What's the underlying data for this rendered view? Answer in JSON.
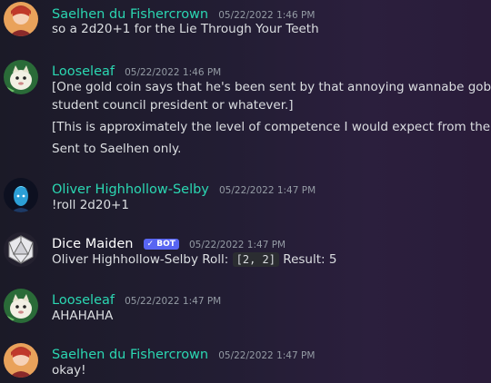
{
  "messages": [
    {
      "author": "Saelhen du Fishercrown",
      "timestamp": "05/22/2022 1:46 PM",
      "name_color": "#2bd7b2",
      "avatar": "saelhen-avatar",
      "lines": [
        "so a 2d20+1 for the Lie Through Your Teeth"
      ]
    },
    {
      "author": "Looseleaf",
      "timestamp": "05/22/2022 1:46 PM",
      "name_color": "#2bd7b2",
      "avatar": "looseleaf-avatar",
      "lines": [
        "[One gold coin says that he's been sent by that annoying wannabe goblin",
        "student council president or whatever.]",
        "[This is approximately the level of competence I would expect from them!]",
        "Sent to Saelhen only."
      ]
    },
    {
      "author": "Oliver Highhollow-Selby",
      "timestamp": "05/22/2022 1:47 PM",
      "name_color": "#2bd7b2",
      "avatar": "oliver-avatar",
      "lines": [
        "!roll 2d20+1"
      ]
    },
    {
      "author": "Dice Maiden",
      "badge": "✓ BOT",
      "timestamp": "05/22/2022 1:47 PM",
      "name_color": "#ffffff",
      "avatar": "dice-avatar",
      "roll_prefix": "Oliver Highhollow-Selby Roll:",
      "roll_code": "[2, 2]",
      "roll_suffix": "Result: 5"
    },
    {
      "author": "Looseleaf",
      "timestamp": "05/22/2022 1:47 PM",
      "name_color": "#2bd7b2",
      "avatar": "looseleaf-avatar",
      "lines": [
        "AHAHAHA"
      ]
    },
    {
      "author": "Saelhen du Fishercrown",
      "timestamp": "05/22/2022 1:47 PM",
      "name_color": "#2bd7b2",
      "avatar": "saelhen-avatar",
      "lines": [
        "okay!"
      ]
    }
  ]
}
